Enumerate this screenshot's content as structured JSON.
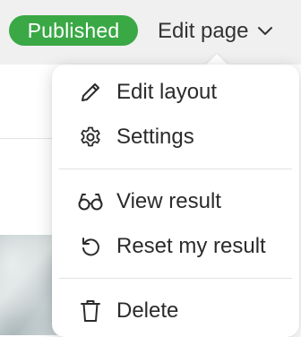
{
  "header": {
    "status_badge": "Published",
    "edit_page_label": "Edit page"
  },
  "menu": {
    "items": [
      {
        "label": "Edit layout",
        "icon": "pencil-icon"
      },
      {
        "label": "Settings",
        "icon": "gear-icon"
      },
      {
        "label": "View result",
        "icon": "glasses-icon"
      },
      {
        "label": "Reset my result",
        "icon": "undo-icon"
      },
      {
        "label": "Delete",
        "icon": "trash-icon"
      }
    ]
  },
  "colors": {
    "badge": "#3aa845",
    "text": "#2b2b2b"
  }
}
